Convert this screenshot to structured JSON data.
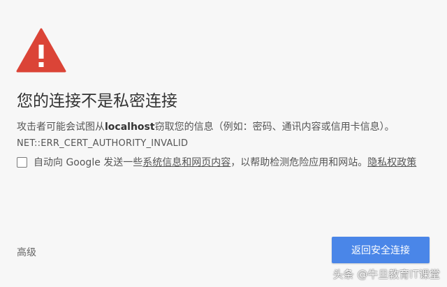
{
  "page": {
    "title": "您的连接不是私密连接",
    "description_before": "攻击者可能会试图从",
    "host": "localhost",
    "description_after": "窃取您的信息（例如：密码、通讯内容或信用卡信息）。",
    "error_code": "NET::ERR_CERT_AUTHORITY_INVALID"
  },
  "optin": {
    "text_before": "自动向 Google 发送一些",
    "link1": "系统信息和网页内容",
    "text_middle": "，以帮助检测危险应用和网站。",
    "link2": "隐私权政策",
    "checked": false
  },
  "footer": {
    "advanced_label": "高级",
    "back_button_label": "返回安全连接"
  },
  "watermark": "头条 @牛旦教育IT课堂",
  "colors": {
    "background": "#f7f7f7",
    "warning_red": "#db4437",
    "button_blue": "#4a86e8",
    "text": "#333333"
  },
  "icons": {
    "warning": "warning-triangle-icon"
  }
}
